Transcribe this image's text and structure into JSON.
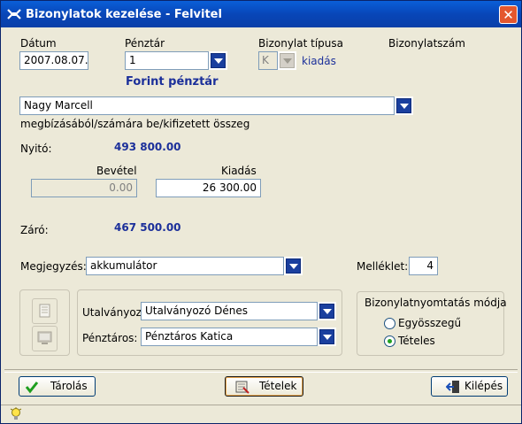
{
  "window": {
    "title": "Bizonylatok kezelése - Felvitel"
  },
  "fields": {
    "datum_label": "Dátum",
    "datum_value": "2007.08.07.",
    "penztar_label": "Pénztár",
    "penztar_value": "1",
    "penztar_name": "Forint pénztár",
    "biztipus_label": "Bizonylat típusa",
    "biztipus_value": "K",
    "biztipus_text": "kiadás",
    "bizszam_label": "Bizonylatszám",
    "partner_value": "Nagy Marcell",
    "partner_caption": "megbízásából/számára  be/kifizetett összeg",
    "nyito_label": "Nyitó:",
    "nyito_value": "493 800.00",
    "bevetel_label": "Bevétel",
    "bevetel_value": "0.00",
    "kiadas_label": "Kiadás",
    "kiadas_value": "26 300.00",
    "zaro_label": "Záró:",
    "zaro_value": "467 500.00",
    "megjegyzes_label": "Megjegyzés:",
    "megjegyzes_value": "akkumulátor",
    "melleklet_label": "Melléklet:",
    "melleklet_value": "4",
    "utalvanyozo_label": "Utalványozó:",
    "utalvanyozo_value": "Utalványozó Dénes",
    "penztaros_label": "Pénztáros:",
    "penztaros_value": "Pénztáros Katica"
  },
  "print_mode": {
    "title": "Bizonylatnyomtatás módja",
    "options": [
      "Egyösszegű",
      "Tételes"
    ],
    "selected": "Tételes"
  },
  "buttons": {
    "save": "Tárolás",
    "items": "Tételek",
    "exit": "Kilépés"
  },
  "colors": {
    "accent_blue": "#1b2f9a",
    "titlebar": "#0846b8",
    "close": "#e4572e"
  }
}
